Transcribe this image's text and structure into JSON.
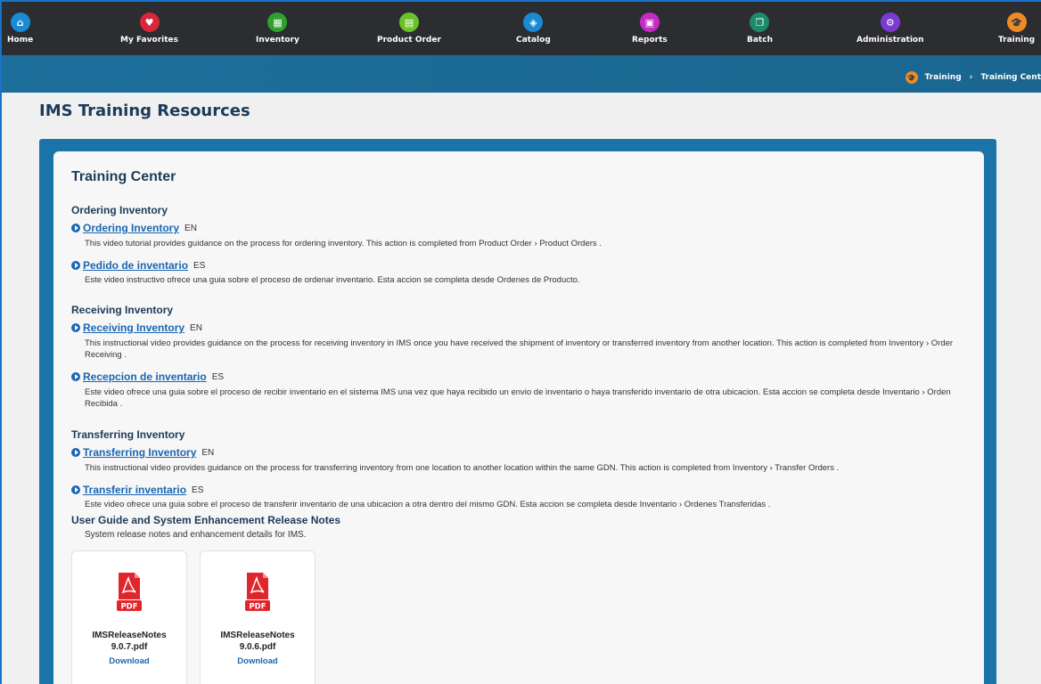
{
  "nav": {
    "items": [
      {
        "label": "Home",
        "icon": "home-icon",
        "color": "#1a8ad4"
      },
      {
        "label": "My Favorites",
        "icon": "heart-icon",
        "color": "#d9263a"
      },
      {
        "label": "Inventory",
        "icon": "boxes-icon",
        "color": "#2ea12e"
      },
      {
        "label": "Product Order",
        "icon": "clipboard-icon",
        "color": "#6cc02a"
      },
      {
        "label": "Catalog",
        "icon": "catalog-icon",
        "color": "#1a8ad4"
      },
      {
        "label": "Reports",
        "icon": "report-icon",
        "color": "#c42bc4"
      },
      {
        "label": "Batch",
        "icon": "batch-icon",
        "color": "#1d8a6a"
      },
      {
        "label": "Administration",
        "icon": "gear-icon",
        "color": "#7a3bd0"
      },
      {
        "label": "Training",
        "icon": "graduation-cap-icon",
        "color": "#f08a24"
      }
    ]
  },
  "breadcrumb": {
    "items": [
      "Training",
      "Training Cent"
    ]
  },
  "page_title": "IMS Training Resources",
  "card_title": "Training Center",
  "sections": {
    "ordering": {
      "heading": "Ordering Inventory",
      "videos": [
        {
          "title": "Ordering Inventory",
          "lang": "EN",
          "desc": "This video tutorial provides guidance on the process for ordering inventory. This action is completed from Product Order › Product Orders ."
        },
        {
          "title": "Pedido de inventario",
          "lang": "ES",
          "desc": "Este video instructivo ofrece una guia sobre el proceso de ordenar inventario. Esta accion se completa desde Ordenes de Producto."
        }
      ]
    },
    "receiving": {
      "heading": "Receiving Inventory",
      "videos": [
        {
          "title": "Receiving Inventory",
          "lang": "EN",
          "desc": "This instructional video provides guidance on the process for receiving inventory in IMS once you have received the shipment of inventory or transferred inventory from another location. This action is completed from Inventory › Order Receiving ."
        },
        {
          "title": "Recepcion de inventario",
          "lang": "ES",
          "desc": "Este video ofrece una guia sobre el proceso de recibir inventario en el sistema IMS una vez que haya recibido un envio de inventario o haya transferido inventario de otra ubicacion. Esta accion se completa desde Inventario › Orden Recibida ."
        }
      ]
    },
    "transferring": {
      "heading": "Transferring Inventory",
      "videos": [
        {
          "title": "Transferring Inventory",
          "lang": "EN",
          "desc": "This instructional video provides guidance on the process for transferring inventory from one location to another location within the same GDN. This action is completed from Inventory › Transfer Orders ."
        },
        {
          "title": "Transferir inventario",
          "lang": "ES",
          "desc": "Este video ofrece una guia sobre el proceso de transferir inventario de una ubicacion a otra dentro del mismo GDN. Esta accion se completa desde Inventario › Ordenes Transferidas ."
        }
      ]
    }
  },
  "user_guide": {
    "title": "User Guide and System Enhancement Release Notes",
    "subtitle": "System release notes and enhancement details for IMS.",
    "files": [
      {
        "name_line1": "IMSReleaseNotes",
        "name_line2": "9.0.7.pdf",
        "action": "Download",
        "badge": "PDF"
      },
      {
        "name_line1": "IMSReleaseNotes",
        "name_line2": "9.0.6.pdf",
        "action": "Download",
        "badge": "PDF"
      }
    ]
  },
  "colors": {
    "nav_bg": "#2b2d30",
    "banner": "#1d6f9b",
    "frame": "#1b74a8",
    "link": "#1a66b2",
    "heading": "#1c3a5a",
    "pdf_red": "#e0252b"
  }
}
